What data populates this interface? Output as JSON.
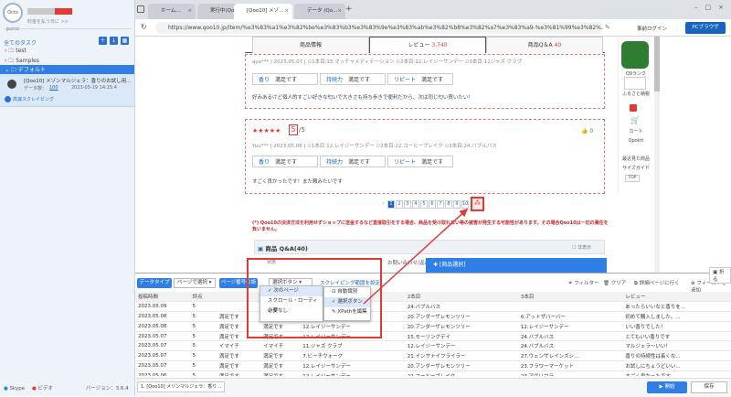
{
  "left": {
    "logo": "Octo parse",
    "plan": "料金を払う日に >>",
    "all_tasks": "全てのタスク",
    "tree": [
      {
        "label": "test"
      },
      {
        "label": "Samples"
      },
      {
        "label": "デフォルト"
      }
    ],
    "task": {
      "title": "[Qoo10] メゾンマルジェラ：香りのお試し用...",
      "count_label": "データ数：",
      "count": "100",
      "time": "2023-05-19 14:15:4",
      "status": "高速スクレイピング"
    },
    "footer": {
      "skype": "Skype",
      "video": "ビデオ",
      "version": "バージョン：3.6.4"
    }
  },
  "browser": {
    "tabs": [
      "ホーム...",
      "実行中(Qo...",
      "[Qoo10] メゾ...",
      "データ (Qo..."
    ],
    "url": "https://www.qoo10.jp/item/%e3%83%a1%e3%82%be%e3%83%b3%e3%83%9e%e3%83%ab%e3%82%b8%e3%82%a7%e3%83%a9-%e3%81%99%e3%82%...",
    "pre_login": "事前ログイン",
    "pc_browser": "PCブラウザ"
  },
  "page": {
    "tabs": [
      {
        "label": "商品情報"
      },
      {
        "label": "レビュー",
        "count": "3,740"
      },
      {
        "label": "商品Q＆A",
        "count": "40"
      }
    ],
    "review1": {
      "user": "aya***",
      "date": "2023.05.07",
      "items": [
        "1本目:15.マッチャメディテーション",
        "2本目:12.レイジーサンデー",
        "3本目:11ジャズ クラブ"
      ],
      "ratings": [
        {
          "k": "香り",
          "v": "満足です"
        },
        {
          "k": "持続力",
          "v": "満足です"
        },
        {
          "k": "リピート",
          "v": "満足です"
        }
      ],
      "text": "好みあるけど個人的すごい好きな匂いで大きさも持ち歩きで便利だから、次は同じ匂い買いたい！"
    },
    "review2": {
      "stars": "★★★★★",
      "score": "5",
      "out_of": "/5",
      "user": "Yuu***",
      "date": "2023.05.06",
      "items": [
        "1本目:12.レイジーサンデー",
        "2本目:22.コーヒーブレイク",
        "3本目:24.バブルバス"
      ],
      "ratings": [
        {
          "k": "香り",
          "v": "満足です"
        },
        {
          "k": "持続力",
          "v": "満足です"
        },
        {
          "k": "リピート",
          "v": "満足です"
        }
      ],
      "text": "すごく良かったです！また頼みたいです",
      "like": "0"
    },
    "pages": [
      "1",
      "2",
      "3",
      "4",
      "5",
      "6",
      "7",
      "8",
      "9",
      "10"
    ],
    "notice": "(*) Qoo10の決済方法を利用せずショップに送金するなど直接取引をする場合、商品を受け取れない等の被害が発生する可能性があります。その場合Qoo10は一切の責任を負いません。",
    "qa_title": "商品 Q&A(40)",
    "qa_private": "非表示",
    "qa_status": "状態",
    "qa_inquiry": "お問い合わせ/返品",
    "product_select": "[商品選択]"
  },
  "sidebar": {
    "items": [
      "Q9ランク",
      "ふるさと納税",
      "カート",
      "Qpoint",
      "最近見た商品",
      "サイズガイド",
      "TOP"
    ]
  },
  "bottom": {
    "data_type": "データタイプ",
    "page_select": "ページで選択",
    "page_num": "ページ番号の設定",
    "select_btn": "選択ボタン",
    "scrape_link": "スクレイピング範囲を設定",
    "menu1": [
      "次のページ",
      "スクロール・ローディング",
      "必要なし"
    ],
    "menu2": [
      "自動識別",
      "選択ボタン",
      "XPathを編集"
    ],
    "filter": "フィルター",
    "clear": "クリア",
    "detail_link": "詳細ページに行く",
    "add_field": "フィールドを追加",
    "collapse": "折る",
    "columns": [
      "投稿時間",
      "評点",
      "",
      "",
      "",
      "リピート",
      "1本目",
      "2本目",
      "3本目",
      "レビュー"
    ],
    "rows": [
      [
        "2023.05.09",
        "5",
        "",
        "",
        "",
        "満足です",
        "27.ウェンザレインズシ...",
        "24.バブルバス",
        "",
        "あったらいいなと香りを..."
      ],
      [
        "2023.05.08",
        "5",
        "",
        "満足です",
        "",
        "満足です",
        "12.レイジーサンデー",
        "20.アンダーザレモンツリー",
        "6.アットザバーバー",
        "初めて購入しました。..."
      ],
      [
        "2023.05.08",
        "5",
        "",
        "満足です",
        "",
        "満足です",
        "12.レイジーサンデー",
        "20.アンダーザレモンツリー",
        "12.レイジーサンデー",
        "いい香りでした！"
      ],
      [
        "2023.05.07",
        "5",
        "",
        "満足です",
        "",
        "満足です",
        "12.レイジーサンデー",
        "15.モーリングデイ",
        "24.バブルバス",
        "とてもいい香りです"
      ],
      [
        "2023.05.07",
        "5",
        "",
        "イマイチ",
        "",
        "イマイチ",
        "11.ジャズ クラブ",
        "12.レイジーサンデー",
        "24.バブルバス",
        "マルジェラ～いい！"
      ],
      [
        "2023.05.07",
        "5",
        "",
        "満足です",
        "",
        "満足です",
        "7.ビーチウォーク",
        "21.インサナイフライラー",
        "27.ウェンザレインズシ...",
        "香りの持続性は長くな..."
      ],
      [
        "2023.05.07",
        "5",
        "",
        "満足です",
        "",
        "満足です",
        "12.レイジーサンデー",
        "20.アンダーザレモンツリー",
        "23.フラワーマーケット",
        "お試しにちょうどいい..."
      ],
      [
        "2023.05.06",
        "5",
        "",
        "満足です",
        "",
        "満足です",
        "12.レイジーサンデー",
        "22.コーヒーブレイク",
        "23.アグリコラ",
        "すごく良かったです..."
      ]
    ],
    "status_tab": "1. [Qoo10] メゾンマルジェラ：香り...",
    "start": "開始",
    "save": "保存"
  }
}
